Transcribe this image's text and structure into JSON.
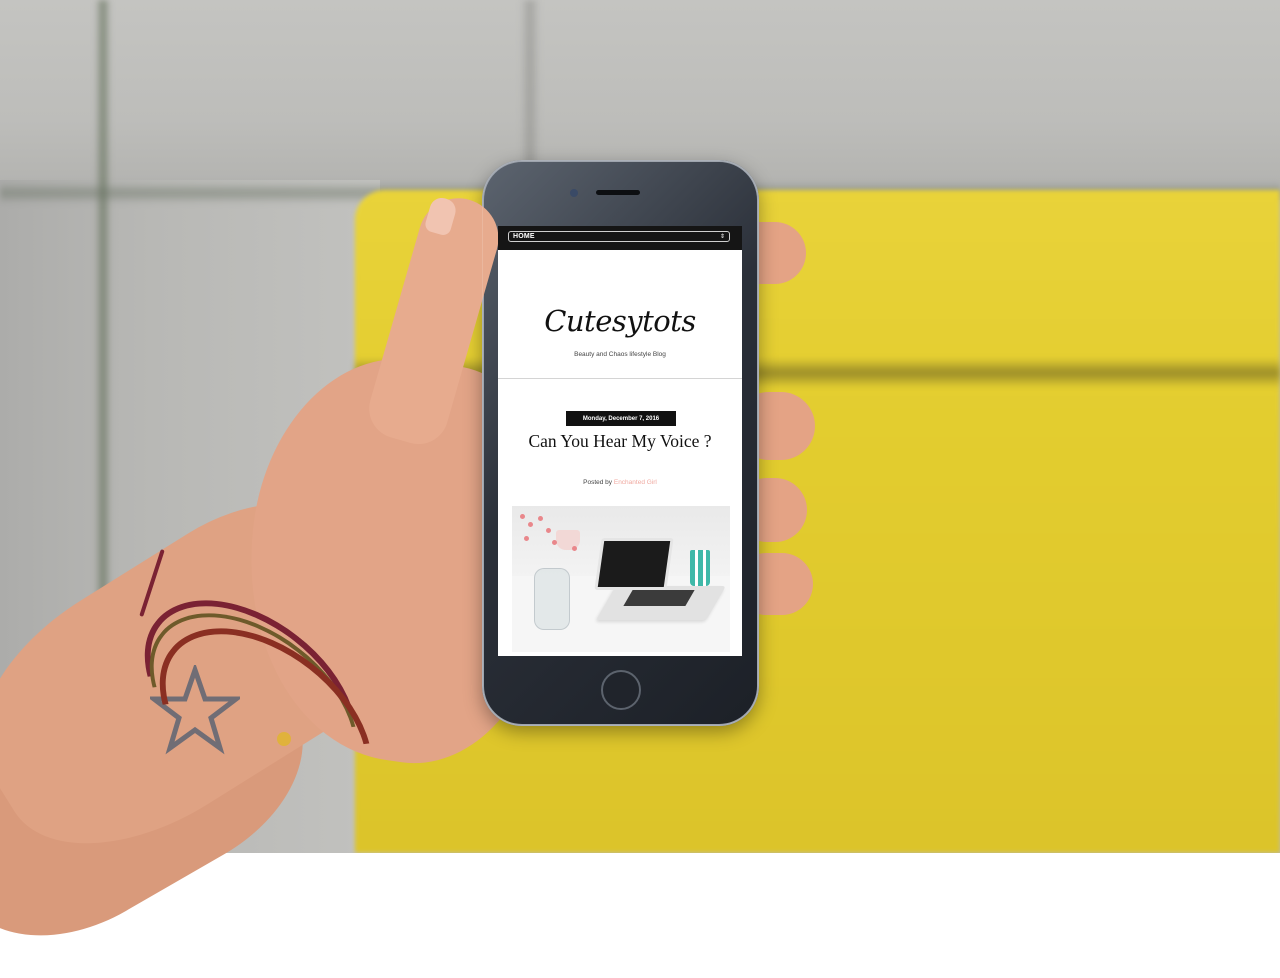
{
  "nav": {
    "menu_label": "HOME",
    "menu_arrows": "⇕"
  },
  "blog": {
    "title": "Cutesytots",
    "tagline": "Beauty and Chaos lifestyle Blog"
  },
  "post": {
    "date": "Monday, December 7, 2016",
    "title": "Can You Hear My Voice ?",
    "byline_prefix": "Posted by",
    "author": "Enchanted Girl"
  },
  "colors": {
    "nav_bg": "#151515",
    "author_link": "#f0a9a0",
    "date_badge_bg": "#111111",
    "background_yellow": "#e3cd2f"
  },
  "icons": {
    "select_arrows": "up-down-chevron-icon",
    "star_tattoo": "star-icon"
  }
}
